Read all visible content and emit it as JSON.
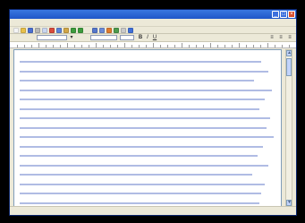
{
  "window": {
    "title": "",
    "titlebar_color": "#1f56c8"
  },
  "menubar": {
    "items": [
      "",
      "",
      "",
      "",
      "",
      "",
      ""
    ]
  },
  "toolbar": {
    "buttons": [
      {
        "icon": "new-doc-icon",
        "color": "#f4f4f4"
      },
      {
        "icon": "open-icon",
        "color": "#e8c04a"
      },
      {
        "icon": "save-icon",
        "color": "#4a6fd0"
      },
      {
        "icon": "print-icon",
        "color": "#b7b7b7"
      },
      {
        "icon": "preview-icon",
        "color": "#c9d6f0"
      },
      {
        "icon": "cut-icon",
        "color": "#d94b3b"
      },
      {
        "icon": "copy-icon",
        "color": "#5b82d8"
      },
      {
        "icon": "paste-icon",
        "color": "#d1a646"
      },
      {
        "icon": "undo-icon",
        "color": "#3d9b3d"
      },
      {
        "icon": "redo-icon",
        "color": "#3d9b3d"
      },
      {
        "icon": "link-icon",
        "color": "#5577cc"
      },
      {
        "icon": "table-icon",
        "color": "#6b8ad6"
      },
      {
        "icon": "chart-icon",
        "color": "#e07a2e"
      },
      {
        "icon": "drawing-icon",
        "color": "#4d9a4d"
      },
      {
        "icon": "zoom-icon",
        "color": "#c9c9c9"
      },
      {
        "icon": "help-icon",
        "color": "#3f6fd8"
      }
    ]
  },
  "formatbar": {
    "style_value": "",
    "font_value": "",
    "size_value": ""
  },
  "document": {
    "text": ""
  },
  "statusbar": {
    "text": ""
  }
}
